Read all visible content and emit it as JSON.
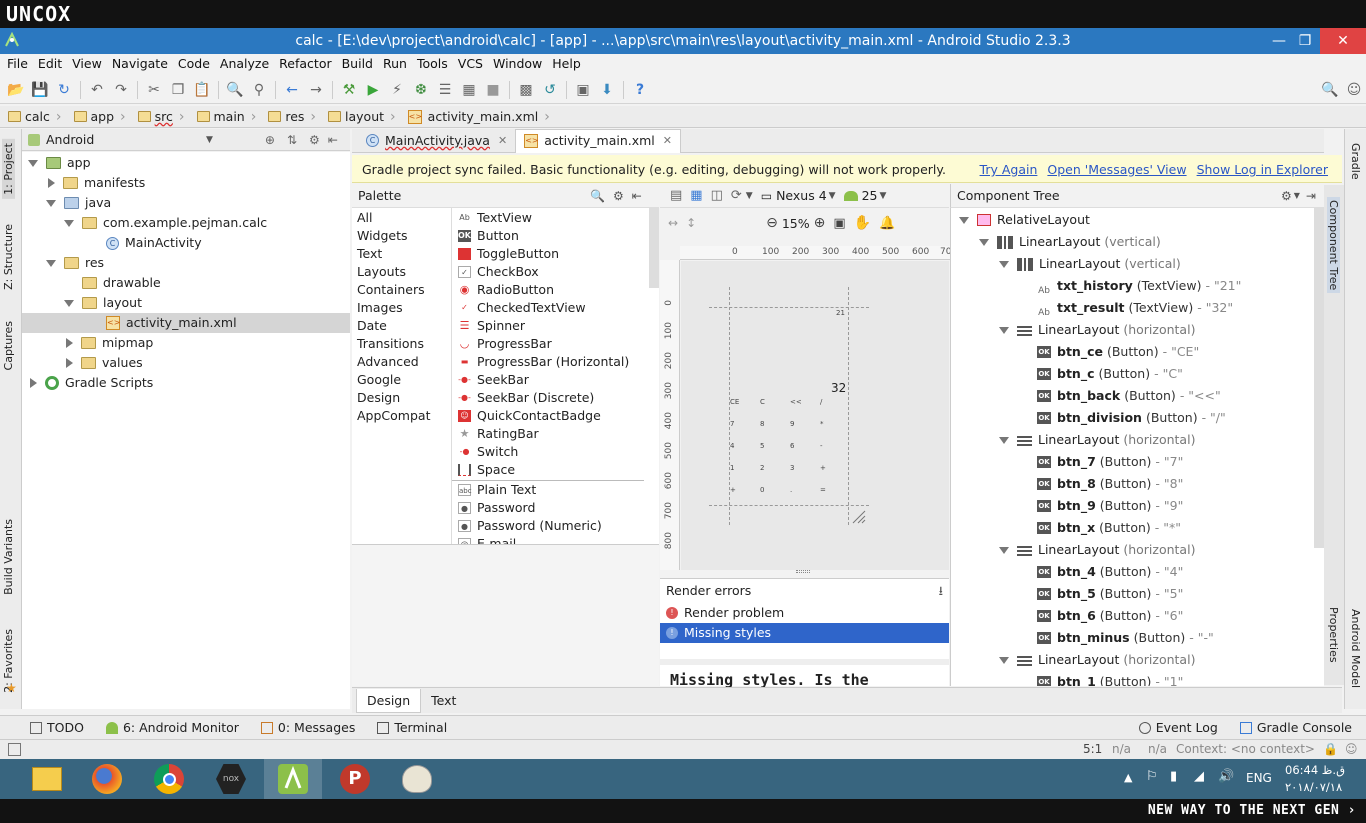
{
  "brand": {
    "logo": "UNCOX",
    "tagline": "NEW WAY TO THE NEXT GEN ›"
  },
  "window": {
    "title": "calc - [E:\\dev\\project\\android\\calc] - [app] - ...\\app\\src\\main\\res\\layout\\activity_main.xml - Android Studio 2.3.3"
  },
  "menu": [
    "File",
    "Edit",
    "View",
    "Navigate",
    "Code",
    "Analyze",
    "Refactor",
    "Build",
    "Run",
    "Tools",
    "VCS",
    "Window",
    "Help"
  ],
  "breadcrumb": [
    "calc",
    "app",
    "src",
    "main",
    "res",
    "layout",
    "activity_main.xml"
  ],
  "left_tabs": [
    "1: Project",
    "Z: Structure",
    "Captures",
    "Build Variants",
    "2: Favorites"
  ],
  "right_tabs": [
    "Gradle",
    "Component Tree",
    "Properties",
    "Android Model"
  ],
  "project": {
    "view_selector": "Android",
    "tree": [
      {
        "label": "app",
        "depth": 0,
        "icon": "folder-app",
        "state": "open"
      },
      {
        "label": "manifests",
        "depth": 1,
        "icon": "folder",
        "state": "closed"
      },
      {
        "label": "java",
        "depth": 1,
        "icon": "folder-blue",
        "state": "open"
      },
      {
        "label": "com.example.pejman.calc",
        "depth": 2,
        "icon": "folder",
        "state": "open"
      },
      {
        "label": "MainActivity",
        "depth": 3,
        "icon": "class-icon",
        "state": "none"
      },
      {
        "label": "res",
        "depth": 1,
        "icon": "folder-res",
        "state": "open"
      },
      {
        "label": "drawable",
        "depth": 2,
        "icon": "folder",
        "state": "none"
      },
      {
        "label": "layout",
        "depth": 2,
        "icon": "folder",
        "state": "open"
      },
      {
        "label": "activity_main.xml",
        "depth": 3,
        "icon": "xml-icon",
        "state": "none",
        "selected": true
      },
      {
        "label": "mipmap",
        "depth": 2,
        "icon": "folder",
        "state": "closed"
      },
      {
        "label": "values",
        "depth": 2,
        "icon": "folder",
        "state": "closed"
      },
      {
        "label": "Gradle Scripts",
        "depth": 0,
        "icon": "gradle-icon",
        "state": "closed"
      }
    ]
  },
  "editor_tabs": [
    {
      "label": "MainActivity.java",
      "active": false
    },
    {
      "label": "activity_main.xml",
      "active": true
    }
  ],
  "notification": {
    "text": "Gradle project sync failed. Basic functionality (e.g. editing, debugging) will not work properly.",
    "links": [
      "Try Again",
      "Open 'Messages' View",
      "Show Log in Explorer"
    ]
  },
  "palette": {
    "title": "Palette",
    "categories": [
      "All",
      "Widgets",
      "Text",
      "Layouts",
      "Containers",
      "Images",
      "Date",
      "Transitions",
      "Advanced",
      "Google",
      "Design",
      "AppCompat"
    ],
    "items": [
      {
        "label": "TextView",
        "icon": "Ab"
      },
      {
        "label": "Button",
        "icon": "OK"
      },
      {
        "label": "ToggleButton",
        "icon": "toggle"
      },
      {
        "label": "CheckBox",
        "icon": "check"
      },
      {
        "label": "RadioButton",
        "icon": "radio"
      },
      {
        "label": "CheckedTextView",
        "icon": "checked"
      },
      {
        "label": "Spinner",
        "icon": "spinner"
      },
      {
        "label": "ProgressBar",
        "icon": "progress"
      },
      {
        "label": "ProgressBar (Horizontal)",
        "icon": "hprogress"
      },
      {
        "label": "SeekBar",
        "icon": "seek"
      },
      {
        "label": "SeekBar (Discrete)",
        "icon": "seek"
      },
      {
        "label": "QuickContactBadge",
        "icon": "badge"
      },
      {
        "label": "RatingBar",
        "icon": "star"
      },
      {
        "label": "Switch",
        "icon": "switch"
      },
      {
        "label": "Space",
        "icon": "space"
      },
      {
        "label": "Plain Text",
        "icon": "abc"
      },
      {
        "label": "Password",
        "icon": "lock"
      },
      {
        "label": "Password (Numeric)",
        "icon": "lock"
      },
      {
        "label": "E-mail",
        "icon": "email"
      }
    ]
  },
  "design_toolbar": {
    "device": "Nexus 4",
    "api": "25",
    "zoom": "15%"
  },
  "ruler": {
    "top": [
      "0",
      "100",
      "200",
      "300",
      "400",
      "500",
      "600",
      "70"
    ],
    "left": [
      "0",
      "100",
      "200",
      "300",
      "400",
      "500",
      "600",
      "700",
      "800"
    ]
  },
  "canvas": {
    "history": "21",
    "result": "32",
    "rows": [
      [
        "CE",
        "C",
        "<<",
        "/"
      ],
      [
        "7",
        "8",
        "9",
        "*"
      ],
      [
        "4",
        "5",
        "6",
        "-"
      ],
      [
        "1",
        "2",
        "3",
        "+"
      ],
      [
        "+",
        "0",
        ".",
        "="
      ]
    ]
  },
  "render_errors": {
    "title": "Render errors",
    "items": [
      {
        "label": "Render problem",
        "selected": false
      },
      {
        "label": "Missing styles",
        "selected": true
      }
    ],
    "detail": "Missing styles. Is the"
  },
  "component_tree": {
    "title": "Component Tree",
    "rows": [
      {
        "depth": 0,
        "icon": "rl",
        "name": "RelativeLayout",
        "type": "",
        "val": "",
        "tw": "open",
        "bold": false
      },
      {
        "depth": 1,
        "icon": "lv",
        "name": "LinearLayout",
        "type": "(vertical)",
        "val": "",
        "tw": "open",
        "bold": false
      },
      {
        "depth": 2,
        "icon": "lv",
        "name": "LinearLayout",
        "type": "(vertical)",
        "val": "",
        "tw": "open",
        "bold": false
      },
      {
        "depth": 3,
        "icon": "ab",
        "name": "txt_history",
        "type": "(TextView)",
        "val": "- \"21\"",
        "tw": "none",
        "bold": true
      },
      {
        "depth": 3,
        "icon": "ab",
        "name": "txt_result",
        "type": "(TextView)",
        "val": "- \"32\"",
        "tw": "none",
        "bold": true
      },
      {
        "depth": 2,
        "icon": "lh",
        "name": "LinearLayout",
        "type": "(horizontal)",
        "val": "",
        "tw": "open",
        "bold": false
      },
      {
        "depth": 3,
        "icon": "ok",
        "name": "btn_ce",
        "type": "(Button)",
        "val": "- \"CE\"",
        "tw": "none",
        "bold": true
      },
      {
        "depth": 3,
        "icon": "ok",
        "name": "btn_c",
        "type": "(Button)",
        "val": "- \"C\"",
        "tw": "none",
        "bold": true
      },
      {
        "depth": 3,
        "icon": "ok",
        "name": "btn_back",
        "type": "(Button)",
        "val": "- \"<<\"",
        "tw": "none",
        "bold": true
      },
      {
        "depth": 3,
        "icon": "ok",
        "name": "btn_division",
        "type": "(Button)",
        "val": "- \"/\"",
        "tw": "none",
        "bold": true
      },
      {
        "depth": 2,
        "icon": "lh",
        "name": "LinearLayout",
        "type": "(horizontal)",
        "val": "",
        "tw": "open",
        "bold": false
      },
      {
        "depth": 3,
        "icon": "ok",
        "name": "btn_7",
        "type": "(Button)",
        "val": "- \"7\"",
        "tw": "none",
        "bold": true
      },
      {
        "depth": 3,
        "icon": "ok",
        "name": "btn_8",
        "type": "(Button)",
        "val": "- \"8\"",
        "tw": "none",
        "bold": true
      },
      {
        "depth": 3,
        "icon": "ok",
        "name": "btn_9",
        "type": "(Button)",
        "val": "- \"9\"",
        "tw": "none",
        "bold": true
      },
      {
        "depth": 3,
        "icon": "ok",
        "name": "btn_x",
        "type": "(Button)",
        "val": "- \"*\"",
        "tw": "none",
        "bold": true
      },
      {
        "depth": 2,
        "icon": "lh",
        "name": "LinearLayout",
        "type": "(horizontal)",
        "val": "",
        "tw": "open",
        "bold": false
      },
      {
        "depth": 3,
        "icon": "ok",
        "name": "btn_4",
        "type": "(Button)",
        "val": "- \"4\"",
        "tw": "none",
        "bold": true
      },
      {
        "depth": 3,
        "icon": "ok",
        "name": "btn_5",
        "type": "(Button)",
        "val": "- \"5\"",
        "tw": "none",
        "bold": true
      },
      {
        "depth": 3,
        "icon": "ok",
        "name": "btn_6",
        "type": "(Button)",
        "val": "- \"6\"",
        "tw": "none",
        "bold": true
      },
      {
        "depth": 3,
        "icon": "ok",
        "name": "btn_minus",
        "type": "(Button)",
        "val": "- \"-\"",
        "tw": "none",
        "bold": true
      },
      {
        "depth": 2,
        "icon": "lh",
        "name": "LinearLayout",
        "type": "(horizontal)",
        "val": "",
        "tw": "open",
        "bold": false
      },
      {
        "depth": 3,
        "icon": "ok",
        "name": "btn_1",
        "type": "(Button)",
        "val": "- \"1\"",
        "tw": "none",
        "bold": true
      }
    ]
  },
  "bottom_tabs": [
    {
      "label": "Design",
      "active": true
    },
    {
      "label": "Text",
      "active": false
    }
  ],
  "tool_windows": {
    "left": [
      {
        "label": "TODO",
        "icon": "todo"
      },
      {
        "label": "6: Android Monitor",
        "icon": "android"
      },
      {
        "label": "0: Messages",
        "icon": "messages"
      },
      {
        "label": "Terminal",
        "icon": "terminal"
      }
    ],
    "right": [
      {
        "label": "Event Log",
        "icon": "event"
      },
      {
        "label": "Gradle Console",
        "icon": "console"
      }
    ]
  },
  "status": {
    "position": "5:1",
    "na1": "n/a",
    "na2": "n/a",
    "context": "Context: <no context>"
  },
  "taskbar": {
    "apps": [
      "File Explorer",
      "Firefox",
      "Chrome",
      "Nox",
      "Android Studio",
      "Psiphon",
      "Paint"
    ],
    "lang": "ENG",
    "time": "06:44 ق.ظ",
    "date": "۲۰۱۸/۰۷/۱۸"
  },
  "colors": {
    "title_bar": "#2b78c0",
    "taskbar": "#38657f",
    "selection": "#2f65ca",
    "notification_bg": "#fdfbd4",
    "link": "#2a56c6"
  }
}
